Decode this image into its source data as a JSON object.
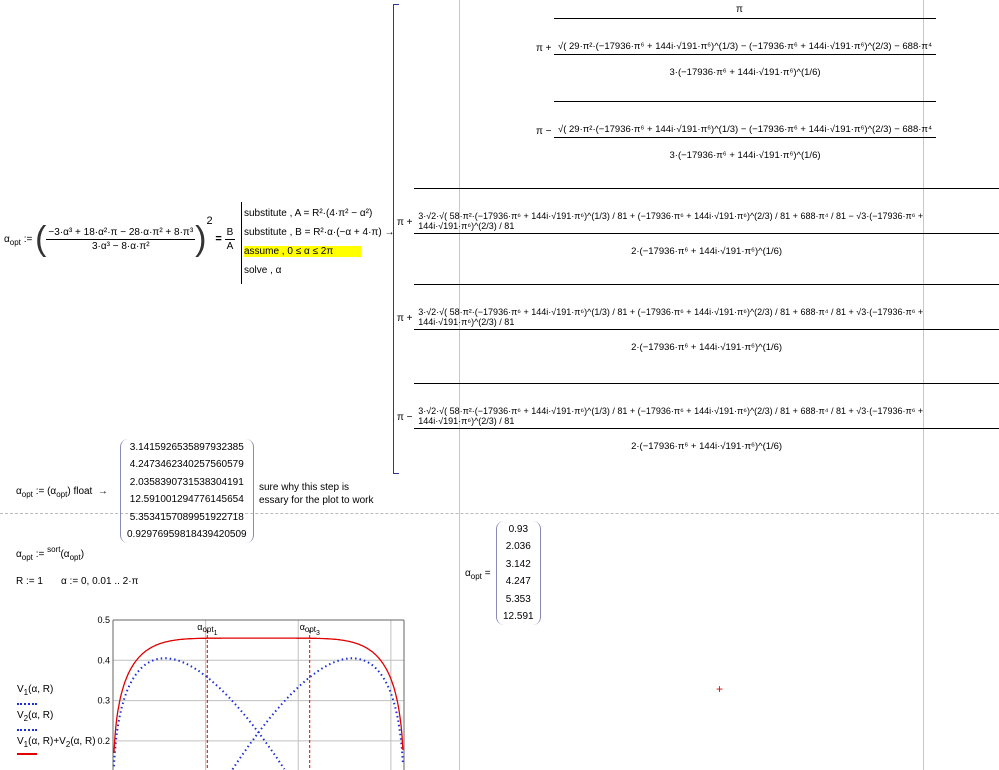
{
  "colors": {
    "accent_red": "#e00000",
    "accent_blue": "#1a2fd6",
    "highlight": "#ffff00",
    "grid": "#c0c0c0"
  },
  "definition": {
    "lhs": "α",
    "lhs_sub": "opt",
    "assign": ":=",
    "numerator": "−3·α³ + 18·α²·π − 28·α·π² + 8·π³",
    "denominator": "3·α³ − 8·α·π²",
    "power": "2",
    "equals": "=",
    "rhs_num": "B",
    "rhs_den": "A",
    "keywords": [
      {
        "text": "substitute , A = R²·(4·π² − α²)",
        "highlight": false
      },
      {
        "text": "substitute , B = R²·α·(−α + 4·π) →",
        "highlight": false
      },
      {
        "text": "assume , 0 ≤ α ≤ 2π",
        "highlight": true
      },
      {
        "text": "solve , α",
        "highlight": false
      }
    ]
  },
  "symbolic_result": [
    {
      "prefix": "",
      "numerator": "π",
      "denominator": ""
    },
    {
      "prefix": "π +",
      "numerator": "√( 29·π²·(−17936·π⁶ + 144i·√191·π⁶)^(1/3) − (−17936·π⁶ + 144i·√191·π⁶)^(2/3) − 688·π⁴",
      "denominator": "3·(−17936·π⁶ + 144i·√191·π⁶)^(1/6)"
    },
    {
      "prefix": "π −",
      "numerator": "√( 29·π²·(−17936·π⁶ + 144i·√191·π⁶)^(1/3) − (−17936·π⁶ + 144i·√191·π⁶)^(2/3) − 688·π⁴",
      "denominator": "3·(−17936·π⁶ + 144i·√191·π⁶)^(1/6)"
    },
    {
      "prefix": "π +",
      "numerator": "3·√2·√( 58·π²·(−17936·π⁶ + 144i·√191·π⁶)^(1/3) / 81 + (−17936·π⁶ + 144i·√191·π⁶)^(2/3) / 81 + 688·π⁴ / 81 − √3·(−17936·π⁶ + 144i·√191·π⁶)^(2/3) / 81",
      "denominator": "2·(−17936·π⁶ + 144i·√191·π⁶)^(1/6)"
    },
    {
      "prefix": "π +",
      "numerator": "3·√2·√( 58·π²·(−17936·π⁶ + 144i·√191·π⁶)^(1/3) / 81 + (−17936·π⁶ + 144i·√191·π⁶)^(2/3) / 81 + 688·π⁴ / 81 + √3·(−17936·π⁶ + 144i·√191·π⁶)^(2/3) / 81",
      "denominator": "2·(−17936·π⁶ + 144i·√191·π⁶)^(1/6)"
    },
    {
      "prefix": "π −",
      "numerator": "3·√2·√( 58·π²·(−17936·π⁶ + 144i·√191·π⁶)^(1/3) / 81 + (−17936·π⁶ + 144i·√191·π⁶)^(2/3) / 81 + 688·π⁴ / 81 + √3·(−17936·π⁶ + 144i·√191·π⁶)^(2/3) / 81",
      "denominator": "2·(−17936·π⁶ + 144i·√191·π⁶)^(1/6)"
    }
  ],
  "float_step": {
    "lhs": "α",
    "lhs_sub": "opt",
    "assign": ":=",
    "arg": "α",
    "arg_sub": "opt",
    "keyword": "float",
    "arrow": "→",
    "values": [
      "3.1415926535897932385",
      "4.2473462340257560579",
      "2.0358390731538304191",
      "12.591001294776145654",
      "5.3534157089951922718",
      "0.92976959818439420509"
    ]
  },
  "comment": [
    "sure why this step is",
    "essary for the plot to work"
  ],
  "sort_step": {
    "lhs": "α",
    "lhs_sub": "opt",
    "assign": ":=",
    "func": "sort",
    "arg": "α",
    "arg_sub": "opt"
  },
  "r_def": "R := 1",
  "alpha_range": "α := 0, 0.01 .. 2·π",
  "sorted_result": {
    "lhs": "α",
    "lhs_sub": "opt",
    "equals": "=",
    "values": [
      "0.93",
      "2.036",
      "3.142",
      "4.247",
      "5.353",
      "12.591"
    ]
  },
  "chart_data": {
    "type": "line",
    "xlim": [
      0,
      6.2832
    ],
    "ylim": [
      0.1,
      0.5
    ],
    "yticks": [
      "0.5",
      "0.4",
      "0.3",
      "0.2"
    ],
    "x_gridlines": [
      2,
      4,
      6
    ],
    "markers": [
      {
        "label": "α",
        "sub": "opt",
        "index": "1",
        "x": 2.036
      },
      {
        "label": "α",
        "sub": "opt",
        "index": "3",
        "x": 4.247
      }
    ],
    "series": [
      {
        "name": "V1(α, R)",
        "style": "dotted",
        "color": "#1a2fd6",
        "peak": {
          "x": 1.12,
          "y": 0.405
        }
      },
      {
        "name": "V2(α, R)",
        "style": "dotted",
        "color": "#1a2fd6",
        "peak": {
          "x": 5.16,
          "y": 0.405
        }
      },
      {
        "name": "V1(α, R)+V2(α, R)",
        "style": "solid",
        "color": "#e00000",
        "plateau": 0.455
      }
    ]
  }
}
